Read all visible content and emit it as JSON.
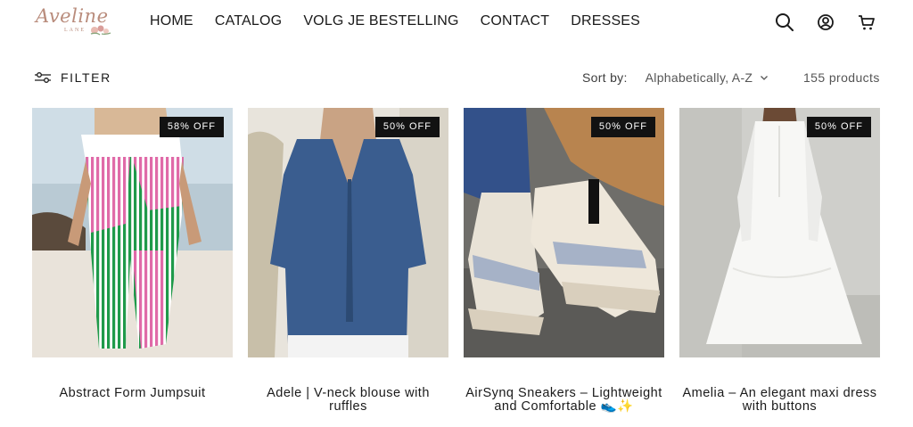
{
  "logo": {
    "script": "Aveline",
    "sub": "LANE"
  },
  "nav": [
    "HOME",
    "CATALOG",
    "VOLG JE BESTELLING",
    "CONTACT",
    "DRESSES"
  ],
  "header_icons": [
    "search-icon",
    "account-icon",
    "cart-icon"
  ],
  "toolbar": {
    "filter_label": "FILTER",
    "sort_label": "Sort by:",
    "sort_value": "Alphabetically, A-Z",
    "count_text": "155 products"
  },
  "products": [
    {
      "title": "Abstract Form Jumpsuit",
      "badge": "58% OFF"
    },
    {
      "title": "Adele | V-neck blouse with ruffles",
      "badge": "50% OFF"
    },
    {
      "title": "AirSynq Sneakers – Lightweight and Comfortable 👟✨",
      "badge": "50% OFF"
    },
    {
      "title": "Amelia – An elegant maxi dress with buttons",
      "badge": "50% OFF"
    }
  ],
  "colors": {
    "accent": "#121212",
    "logo": "#b98c7c",
    "text": "#1a1a1a"
  }
}
